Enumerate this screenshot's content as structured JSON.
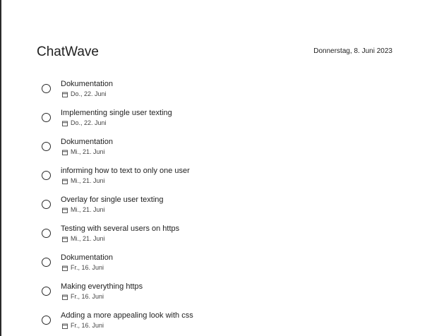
{
  "app": {
    "title": "ChatWave",
    "date": "Donnerstag, 8. Juni 2023"
  },
  "tasks": [
    {
      "title": "Dokumentation",
      "due": "Do., 22. Juni",
      "due_icon": "calendar-icon",
      "completed": false
    },
    {
      "title": "Implementing single user texting",
      "due": "Do., 22. Juni",
      "due_icon": "calendar-icon",
      "completed": false
    },
    {
      "title": "Dokumentation",
      "due": "Mi., 21. Juni",
      "due_icon": "calendar-icon",
      "completed": false
    },
    {
      "title": "informing how to text to only one user",
      "due": "Mi., 21. Juni",
      "due_icon": "calendar-icon",
      "completed": false
    },
    {
      "title": "Overlay for single user texting",
      "due": "Mi., 21. Juni",
      "due_icon": "calendar-icon",
      "completed": false
    },
    {
      "title": "Testing with several users on https",
      "due": "Mi., 21. Juni",
      "due_icon": "calendar-icon",
      "completed": false
    },
    {
      "title": "Dokumentation",
      "due": "Fr., 16. Juni",
      "due_icon": "calendar-icon",
      "completed": false
    },
    {
      "title": "Making everything https",
      "due": "Fr., 16. Juni",
      "due_icon": "calendar-icon",
      "completed": false
    },
    {
      "title": "Adding a more appealing look with css",
      "due": "Fr., 16. Juni",
      "due_icon": "calendar-icon",
      "completed": false
    }
  ]
}
